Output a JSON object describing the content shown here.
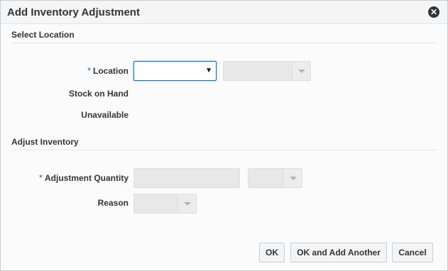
{
  "dialog": {
    "title": "Add Inventory Adjustment",
    "close_icon": "close-icon"
  },
  "select_location": {
    "heading": "Select Location",
    "location_label": "Location",
    "required_marker": "*",
    "location_value": "",
    "stock_on_hand_label": "Stock on Hand",
    "unavailable_label": "Unavailable"
  },
  "adjust_inventory": {
    "heading": "Adjust Inventory",
    "quantity_label": "Adjustment Quantity",
    "required_marker": "*",
    "reason_label": "Reason"
  },
  "footer": {
    "ok_label": "OK",
    "ok_add_another_label": "OK and Add Another",
    "cancel_label": "Cancel"
  },
  "colors": {
    "required": "#0572ce",
    "focus_border": "#0572ce",
    "disabled_fill": "#e8e8e8"
  }
}
